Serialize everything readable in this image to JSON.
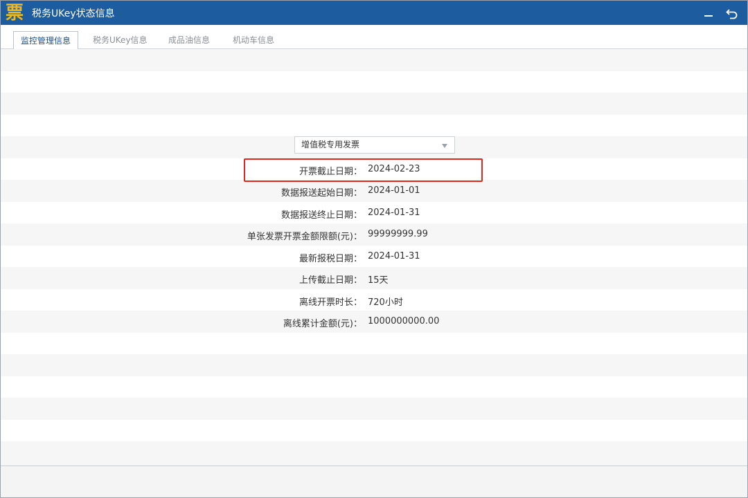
{
  "window": {
    "logo_char": "票",
    "title": "税务UKey状态信息"
  },
  "tabs": [
    {
      "label": "监控管理信息",
      "active": true
    },
    {
      "label": "税务UKey信息",
      "active": false
    },
    {
      "label": "成品油信息",
      "active": false
    },
    {
      "label": "机动车信息",
      "active": false
    }
  ],
  "invoice_type": {
    "selected": "增值税专用发票"
  },
  "fields": [
    {
      "label": "开票截止日期：",
      "value": "2024-02-23"
    },
    {
      "label": "数据报送起始日期：",
      "value": "2024-01-01"
    },
    {
      "label": "数据报送终止日期：",
      "value": "2024-01-31"
    },
    {
      "label": "单张发票开票金额限额(元)：",
      "value": "99999999.99"
    },
    {
      "label": "最新报税日期：",
      "value": "2024-01-31"
    },
    {
      "label": "上传截止日期：",
      "value": "15天"
    },
    {
      "label": "离线开票时长：",
      "value": "720小时"
    },
    {
      "label": "离线累计金额(元)：",
      "value": "1000000000.00"
    }
  ],
  "colors": {
    "titlebar": "#1d5c9e",
    "logo": "#f2b818",
    "highlight": "#e0261f",
    "stripe_light": "#f6f6f6",
    "stripe_white": "#ffffff"
  },
  "icons": {
    "minimize": "minimize-icon",
    "back": "back-arrow-icon"
  }
}
